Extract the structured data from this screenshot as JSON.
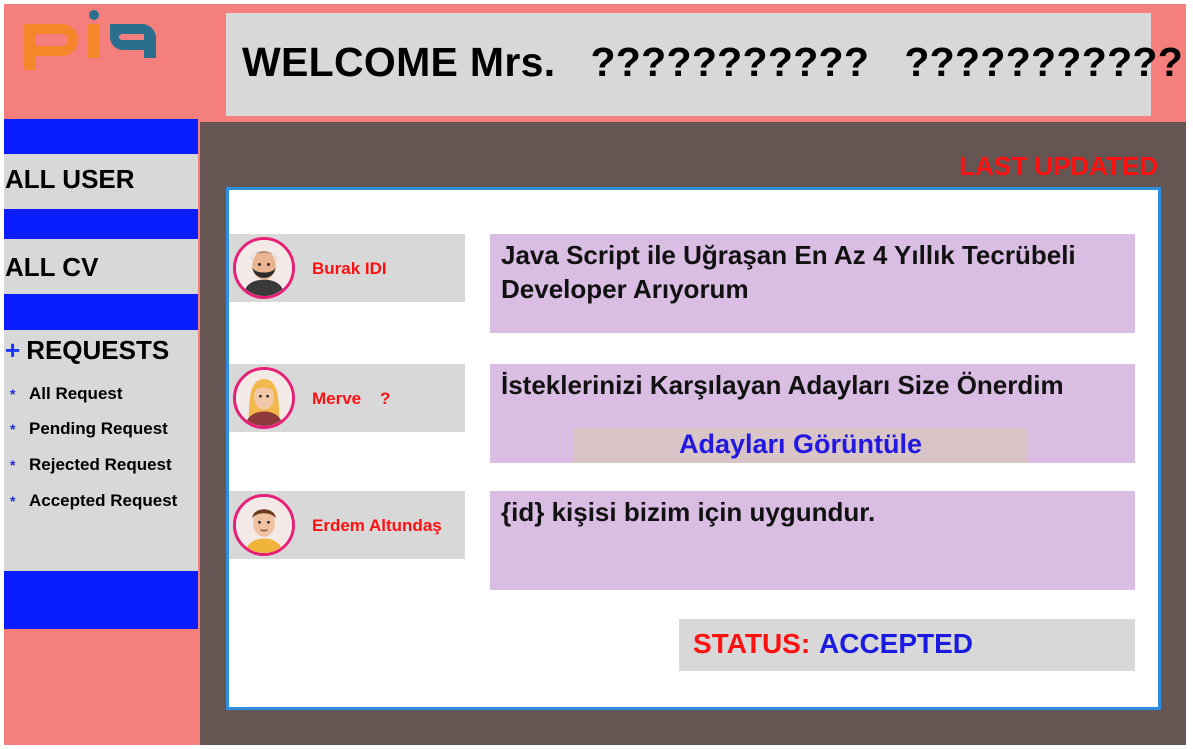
{
  "brand": {
    "logo_text": "pia",
    "primary_color": "#f5872a",
    "secondary_color": "#2b6f8f"
  },
  "header": {
    "welcome": "WELCOME Mrs.   ???????????   ???????????"
  },
  "sidebar": {
    "all_user": "ALL USER",
    "all_cv": "ALL CV",
    "requests_plus": "+",
    "requests": "REQUESTS",
    "sub_items": [
      "All Request",
      "Pending Request",
      "Rejected Request",
      "Accepted Request"
    ],
    "bullet": "*"
  },
  "main": {
    "last_updated": "LAST UPDATED",
    "items": [
      {
        "user": "Burak IDI",
        "message": "Java Script ile Uğraşan En Az 4 Yıllık Tecrübeli Developer Arıyorum"
      },
      {
        "user": "Merve    ?",
        "message": "İsteklerinizi Karşılayan Adayları Size Önerdim",
        "button": "Adayları Görüntüle"
      },
      {
        "user": "Erdem Altundaş",
        "message": "{id} kişisi bizim için uygundur."
      }
    ],
    "status_label": "STATUS:",
    "status_value": "ACCEPTED"
  },
  "icons": [
    "pia-logo",
    "avatar-man-beard-icon",
    "avatar-woman-blonde-icon",
    "avatar-man-icon"
  ],
  "colors": {
    "frame": "#f47f7d",
    "sidebar_blue": "#0a1dff",
    "panel": "#655654",
    "message_bg": "#d9bde3",
    "alert_red": "#ff1010",
    "accent_blue": "#1a1ae0"
  }
}
